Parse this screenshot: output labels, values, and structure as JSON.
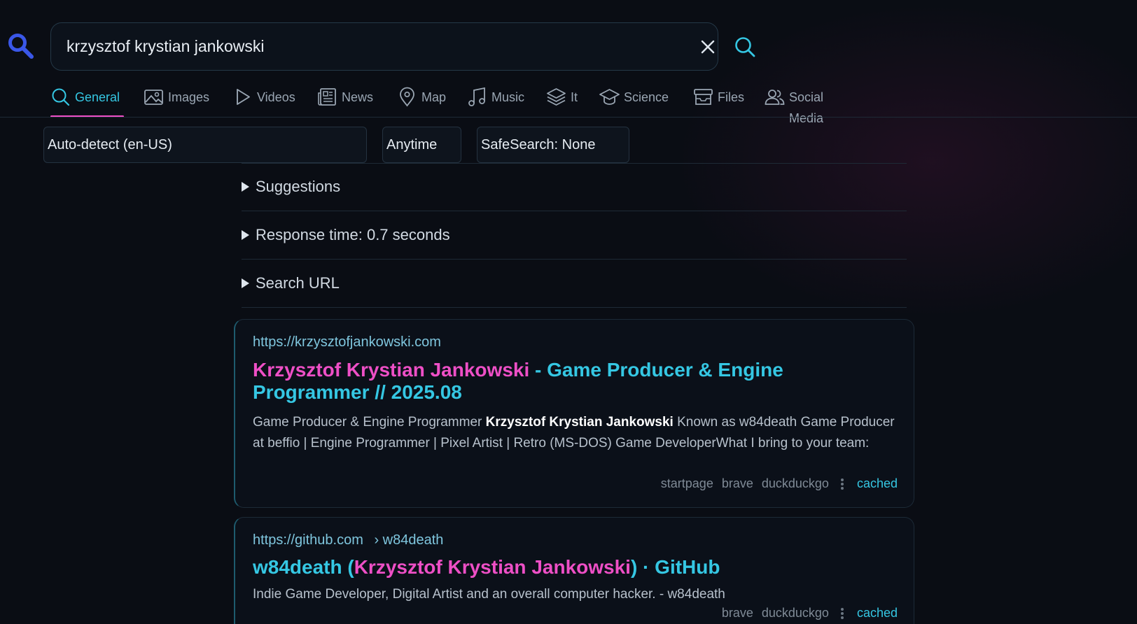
{
  "search": {
    "query": "krzysztof krystian jankowski"
  },
  "tabs": [
    {
      "label": "General",
      "icon": "search-icon",
      "active": true
    },
    {
      "label": "Images",
      "icon": "image-icon"
    },
    {
      "label": "Videos",
      "icon": "play-icon"
    },
    {
      "label": "News",
      "icon": "newspaper-icon"
    },
    {
      "label": "Map",
      "icon": "map-pin-icon"
    },
    {
      "label": "Music",
      "icon": "music-note-icon"
    },
    {
      "label": "It",
      "icon": "layers-icon"
    },
    {
      "label": "Science",
      "icon": "graduation-cap-icon"
    },
    {
      "label": "Files",
      "icon": "archive-icon"
    },
    {
      "label": "Social Media",
      "icon": "users-icon"
    }
  ],
  "filters": {
    "language": "Auto-detect (en-US)",
    "time": "Anytime",
    "safesearch": "SafeSearch: None"
  },
  "details": {
    "suggestions": "Suggestions",
    "response_time": "Response time: 0.7 seconds",
    "search_url": "Search URL"
  },
  "results": [
    {
      "url": "https://krzysztofjankowski.com",
      "title_highlight": "Krzysztof Krystian Jankowski",
      "title_rest_line1": " - Game Producer & Engine",
      "title_rest_line2": "Programmer // 2025.08",
      "snippet_pre": "Game Producer & Engine Programmer ",
      "snippet_bold": "Krzysztof Krystian Jankowski",
      "snippet_post": " Known as w84death Game Producer at beffio | Engine Programmer | Pixel Artist | Retro (MS-DOS) Game DeveloperWhat I bring to your team:",
      "engines": [
        "startpage",
        "brave",
        "duckduckgo"
      ],
      "cached": "cached"
    },
    {
      "url": "https://github.com",
      "crumb": "› w84death",
      "title_pre": "w84death (",
      "title_highlight": "Krzysztof Krystian Jankowski",
      "title_post": ") · GitHub",
      "snippet": "Indie Game Developer, Digital Artist and an overall computer hacker. - w84death",
      "engines": [
        "brave",
        "duckduckgo"
      ],
      "cached": "cached"
    }
  ],
  "colors": {
    "background": "#0a0d14",
    "accent_cyan": "#35c7e3",
    "accent_pink": "#ee4fc6",
    "logo_blue": "#3a57e8"
  }
}
